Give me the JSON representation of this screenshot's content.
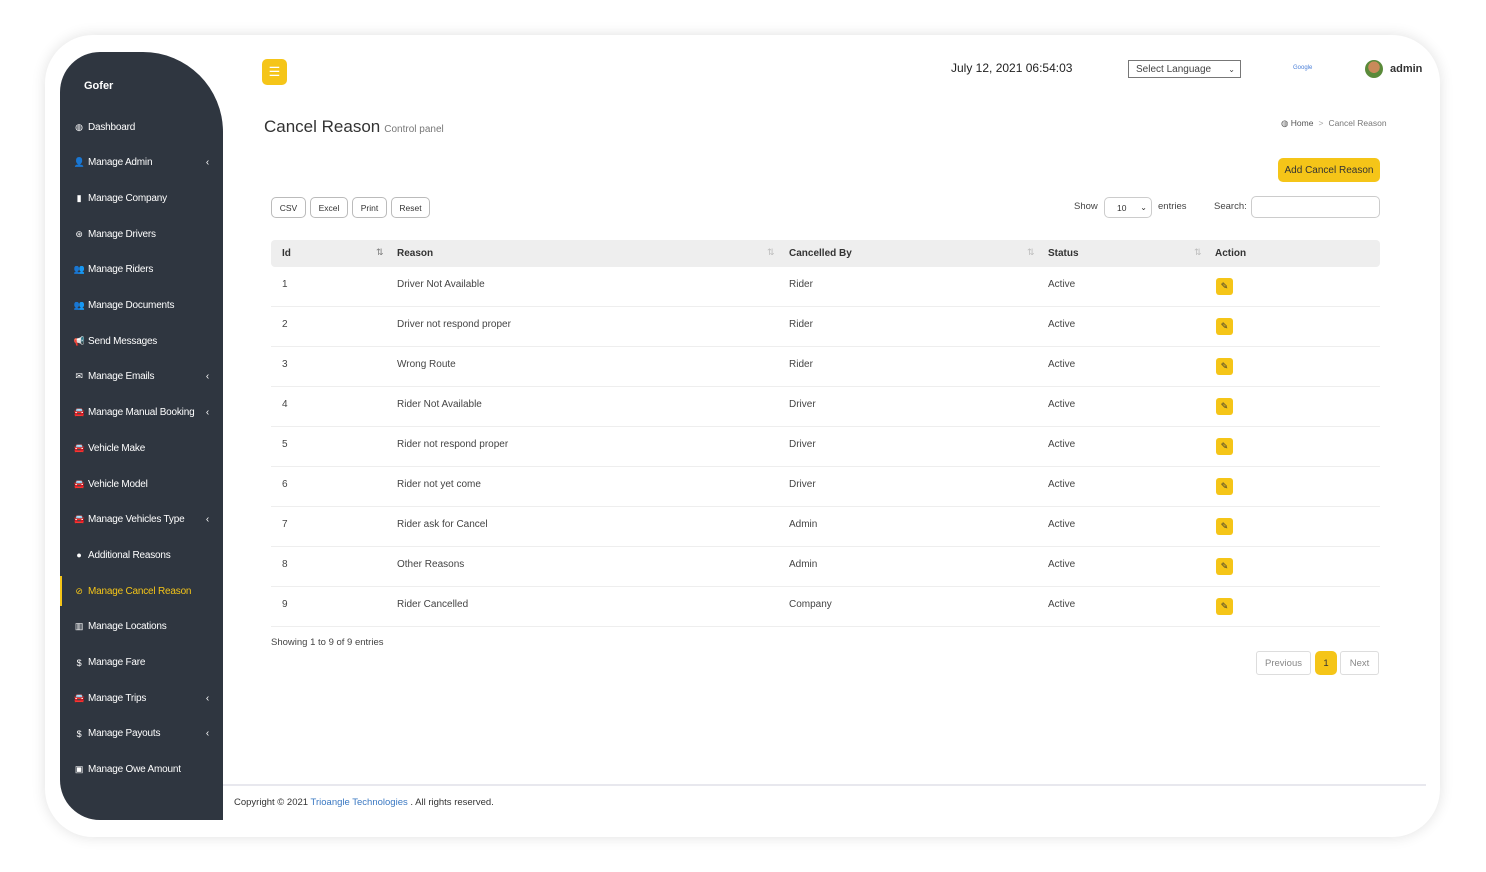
{
  "app": {
    "brand": "Gofer"
  },
  "sidebar": {
    "items": [
      {
        "label": "Dashboard",
        "icon": "dashboard-icon",
        "glyph": "◍",
        "chev": false
      },
      {
        "label": "Manage Admin",
        "icon": "user-plus-icon",
        "glyph": "👤",
        "chev": true
      },
      {
        "label": "Manage Company",
        "icon": "building-icon",
        "glyph": "▮",
        "chev": false
      },
      {
        "label": "Manage Drivers",
        "icon": "steering-wheel-icon",
        "glyph": "⊛",
        "chev": false
      },
      {
        "label": "Manage Riders",
        "icon": "users-icon",
        "glyph": "👥",
        "chev": false
      },
      {
        "label": "Manage Documents",
        "icon": "users-icon",
        "glyph": "👥",
        "chev": false
      },
      {
        "label": "Send Messages",
        "icon": "bullhorn-icon",
        "glyph": "📢",
        "chev": false
      },
      {
        "label": "Manage Emails",
        "icon": "envelope-icon",
        "glyph": "✉",
        "chev": true
      },
      {
        "label": "Manage Manual Booking",
        "icon": "car-icon",
        "glyph": "🚘",
        "chev": true
      },
      {
        "label": "Vehicle Make",
        "icon": "car-icon",
        "glyph": "🚘",
        "chev": false
      },
      {
        "label": "Vehicle Model",
        "icon": "car-icon",
        "glyph": "🚘",
        "chev": false
      },
      {
        "label": "Manage Vehicles Type",
        "icon": "car-icon",
        "glyph": "🚘",
        "chev": true
      },
      {
        "label": "Additional Reasons",
        "icon": "comment-icon",
        "glyph": "●",
        "chev": false
      },
      {
        "label": "Manage Cancel Reason",
        "icon": "ban-icon",
        "glyph": "⊘",
        "chev": false,
        "active": true
      },
      {
        "label": "Manage Locations",
        "icon": "map-icon",
        "glyph": "▥",
        "chev": false
      },
      {
        "label": "Manage Fare",
        "icon": "dollar-icon",
        "glyph": "$",
        "chev": false
      },
      {
        "label": "Manage Trips",
        "icon": "car-icon",
        "glyph": "🚘",
        "chev": true
      },
      {
        "label": "Manage Payouts",
        "icon": "dollar-icon",
        "glyph": "$",
        "chev": true
      },
      {
        "label": "Manage Owe Amount",
        "icon": "money-icon",
        "glyph": "▣",
        "chev": false
      }
    ]
  },
  "header": {
    "datetime": "July 12, 2021 06:54:03",
    "language": "Select Language",
    "google": "Google",
    "user": "admin"
  },
  "page": {
    "title": "Cancel Reason",
    "subtitle": "Control panel",
    "breadcrumb": {
      "home": "Home",
      "current": "Cancel Reason"
    },
    "add_button": "Add Cancel Reason"
  },
  "toolbar": {
    "buttons": [
      "CSV",
      "Excel",
      "Print",
      "Reset"
    ],
    "show": "Show",
    "length": "10",
    "entries": "entries",
    "search_label": "Search:",
    "search_value": ""
  },
  "table": {
    "columns": [
      "Id",
      "Reason",
      "Cancelled By",
      "Status",
      "Action"
    ],
    "rows": [
      [
        "1",
        "Driver Not Available",
        "Rider",
        "Active"
      ],
      [
        "2",
        "Driver not respond proper",
        "Rider",
        "Active"
      ],
      [
        "3",
        "Wrong Route",
        "Rider",
        "Active"
      ],
      [
        "4",
        "Rider Not Available",
        "Driver",
        "Active"
      ],
      [
        "5",
        "Rider not respond proper",
        "Driver",
        "Active"
      ],
      [
        "6",
        "Rider not yet come",
        "Driver",
        "Active"
      ],
      [
        "7",
        "Rider ask for Cancel",
        "Admin",
        "Active"
      ],
      [
        "8",
        "Other Reasons",
        "Admin",
        "Active"
      ],
      [
        "9",
        "Rider Cancelled",
        "Company",
        "Active"
      ]
    ]
  },
  "info": "Showing 1 to 9 of 9 entries",
  "pagination": {
    "previous": "Previous",
    "current": "1",
    "next": "Next"
  },
  "footer": {
    "prefix": "Copyright © 2021",
    "company": "Trioangle Technologies",
    "suffix": ". All rights reserved."
  },
  "colors": {
    "accent": "#f5c518",
    "sidebar": "#2f3640",
    "link": "#3a78c2"
  }
}
